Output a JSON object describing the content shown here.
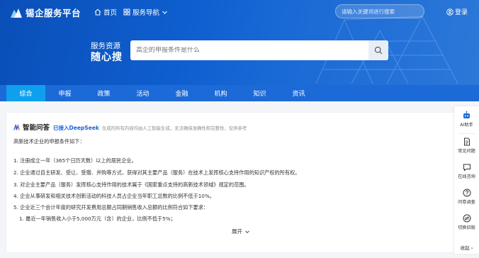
{
  "header": {
    "brand": "锡企服务平台",
    "nav": {
      "home": "首页",
      "services": "服务导航"
    },
    "search_placeholder": "请输入关键词进行搜索",
    "login": "登录"
  },
  "hero": {
    "label_line1": "服务资源",
    "label_line2": "随心搜",
    "search_placeholder": "高企的申报条件是什么"
  },
  "tabs": [
    {
      "label": "综合",
      "active": true
    },
    {
      "label": "申报"
    },
    {
      "label": "政策"
    },
    {
      "label": "活动"
    },
    {
      "label": "金融"
    },
    {
      "label": "机构"
    },
    {
      "label": "知识"
    },
    {
      "label": "资讯"
    }
  ],
  "qa": {
    "title": "智能问答",
    "deepseek": "已接入DeepSeek",
    "disclaimer": "生成的所有内容均由人工智能生成，无法确保准确性和完整性，仅供参考",
    "intro": "高新技术企业的申报条件如下：",
    "items": [
      "1. 注册成立一年（365个日历天数）以上的居民企业。",
      "2. 企业通过自主研发、受让、受赠、并购等方式，获得对其主要产品（服务）在技术上发挥核心支持作用的知识产权的所有权。",
      "3. 对企业主要产品（服务）发挥核心支持作用的技术属于《国家重点支持的高新技术领域》规定的范围。",
      "4. 企业从事研发和相关技术创新活动的科技人员占企业当年职工总数的比例不低于10%。",
      "5. 企业近三个会计年度的研究开发费用总额占同期销售收入总额的比例符合如下要求：",
      "1. 最近一年销售收入小于5,000万元（含）的企业，比例不低于5%；"
    ],
    "expand": "展开"
  },
  "sidebar": {
    "items": [
      {
        "label": "AI助手",
        "icon": "robot-icon"
      },
      {
        "label": "常见问题",
        "icon": "document-icon"
      },
      {
        "label": "在线咨询",
        "icon": "chat-bubble-icon"
      },
      {
        "label": "问卷调查",
        "icon": "question-icon"
      },
      {
        "label": "切换旧版",
        "icon": "switch-icon"
      }
    ],
    "collapse": "收起 ›"
  },
  "colors": {
    "primary": "#1c6ad8",
    "active_tab": "#0ea0ee",
    "link": "#1a64d6"
  }
}
